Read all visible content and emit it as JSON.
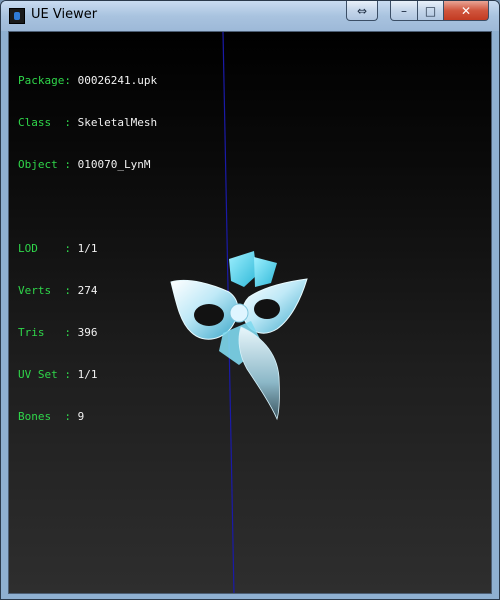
{
  "window": {
    "title": "UE Viewer",
    "icon": "ue-viewer-app-icon"
  },
  "caption_buttons": {
    "resize_glyph": "⇔",
    "minimize_glyph": "–",
    "maximize_glyph": "□",
    "close_glyph": "✕"
  },
  "info": {
    "package": {
      "label": "Package:",
      "value": "00026241.upk"
    },
    "class": {
      "label": "Class  :",
      "value": "SkeletalMesh"
    },
    "object": {
      "label": "Object :",
      "value": "010070_LynM"
    },
    "lod": {
      "label": "LOD    :",
      "value": "1/1"
    },
    "verts": {
      "label": "Verts  :",
      "value": "274"
    },
    "tris": {
      "label": "Tris   :",
      "value": "396"
    },
    "uvset": {
      "label": "UV Set :",
      "value": "1/1"
    },
    "bones": {
      "label": "Bones  :",
      "value": "9"
    }
  },
  "colors": {
    "label_green": "#2fd64a",
    "value_white": "#f2f2f2",
    "axis_blue": "#1a1aa8",
    "mesh_cyan": "#6fd8f0"
  },
  "mesh_subject": "bird-beak-mask-icon"
}
